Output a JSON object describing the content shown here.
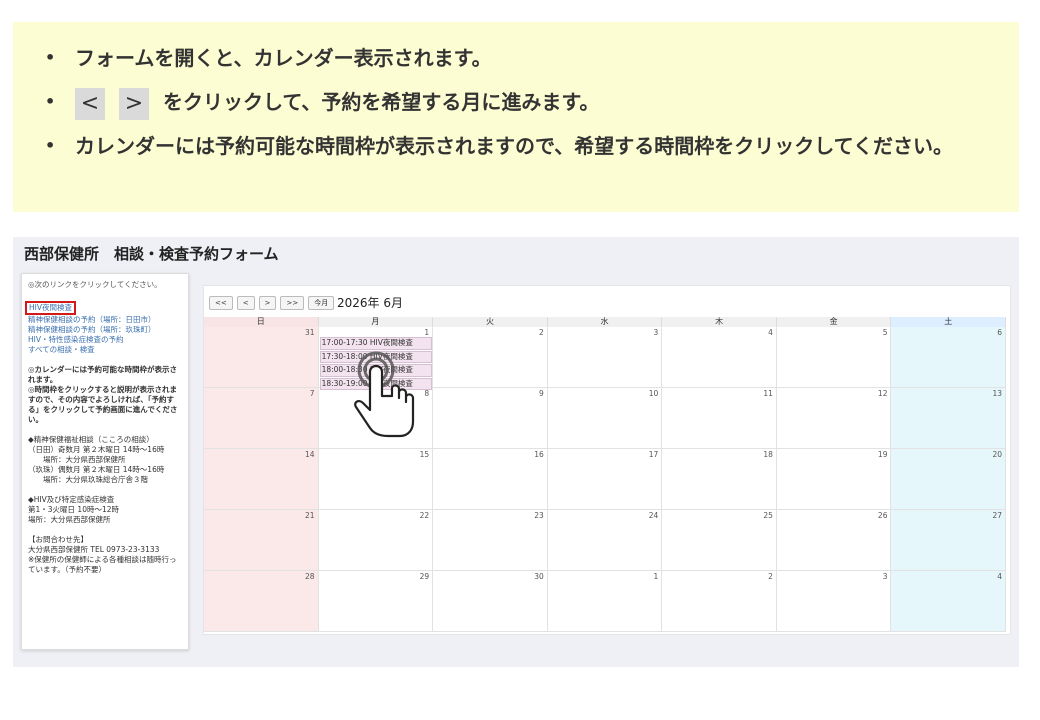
{
  "notice": {
    "line1": "フォームを開くと、カレンダー表示されます。",
    "prev_key": "<",
    "next_key": ">",
    "line2": "をクリックして、予約を希望する月に進みます。",
    "line3": "カレンダーには予約可能な時間枠が表示されますので、希望する時間枠をクリックしてください。"
  },
  "form": {
    "title": "西部保健所　相談・検査予約フォーム",
    "sidebar": {
      "intro": "◎次のリンクをクリックしてください。",
      "links": [
        "HIV夜間検査",
        "精神保健相談の予約（場所：日田市）",
        "精神保健相談の予約（場所：玖珠町）",
        "HIV・特性感染症検査の予約",
        "すべての相談・検査"
      ],
      "info1": "◎カレンダーには予約可能な時間枠が表示されます。\n◎時間枠をクリックすると説明が表示されますので、その内容でよろしければ、「予約する」をクリックして予約画面に進んでください。",
      "info2": "◆精神保健福祉相談（こころの相談）\n（日田）奇数月 第２木曜日 14時～16時\n　　場所：大分県西部保健所\n（玖珠）偶数月 第２木曜日 14時～16時\n　　場所：大分県玖珠総合庁舎３階",
      "info3": "◆HIV及び特定感染症検査\n第1・3火曜日 10時～12時\n場所：大分県西部保健所",
      "info4": "【お問合わせ先】\n大分県西部保健所 TEL 0973-23-3133\n※保健所の保健師による各種相談は随時行っています。（予約不要）"
    },
    "calendar": {
      "buttons": [
        "<<",
        "<",
        ">",
        ">>",
        "今月"
      ],
      "title": "2026年 6月",
      "weekdays": [
        "日",
        "月",
        "火",
        "水",
        "木",
        "金",
        "土"
      ],
      "weeks": [
        [
          "31",
          "1",
          "2",
          "3",
          "4",
          "5",
          "6"
        ],
        [
          "7",
          "8",
          "9",
          "10",
          "11",
          "12",
          "13"
        ],
        [
          "14",
          "15",
          "16",
          "17",
          "18",
          "19",
          "20"
        ],
        [
          "21",
          "22",
          "23",
          "24",
          "25",
          "26",
          "27"
        ],
        [
          "28",
          "29",
          "30",
          "1",
          "2",
          "3",
          "4"
        ]
      ],
      "slots": [
        "17:00-17:30 HIV夜間検査",
        "17:30-18:00 HIV夜間検査",
        "18:00-18:30 HIV夜間検査",
        "18:30-19:00 HIV夜間検査"
      ]
    }
  },
  "colors": {
    "notice_bg": "#fdfdd3",
    "highlight_border": "#d21a1a",
    "link": "#3a6fb0",
    "slot_bg": "#f3e3ee"
  },
  "icons": {
    "pointer": "tap-hand-icon"
  }
}
